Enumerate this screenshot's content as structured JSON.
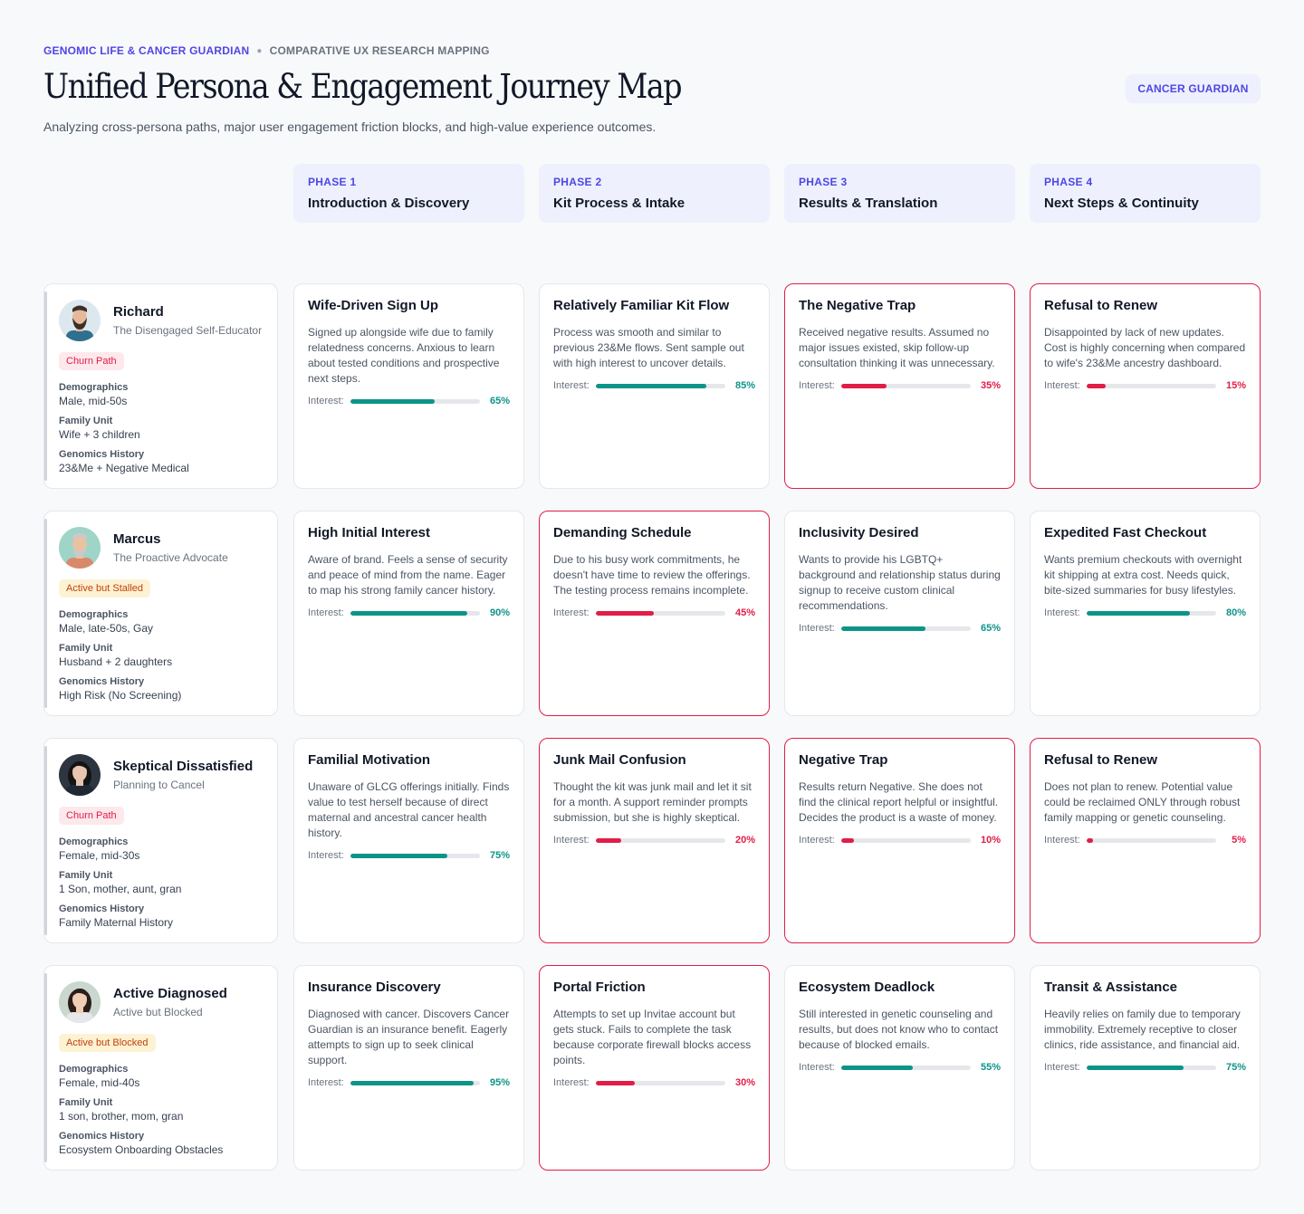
{
  "header": {
    "eyebrow_primary": "GENOMIC LIFE & CANCER GUARDIAN",
    "eyebrow_secondary": "COMPARATIVE UX RESEARCH MAPPING",
    "title": "Unified Persona & Engagement Journey Map",
    "subtitle": "Analyzing cross-persona paths, major user engagement friction blocks, and high-value experience outcomes.",
    "badge": "CANCER GUARDIAN"
  },
  "interest_label": "Interest:",
  "phases": [
    {
      "num": "PHASE 1",
      "title": "Introduction & Discovery"
    },
    {
      "num": "PHASE 2",
      "title": "Kit Process & Intake"
    },
    {
      "num": "PHASE 3",
      "title": "Results & Translation"
    },
    {
      "num": "PHASE 4",
      "title": "Next Steps & Continuity"
    }
  ],
  "personas": [
    {
      "name": "Richard",
      "role": "The Disengaged Self-Educator",
      "status": "Churn Path",
      "status_kind": "churn",
      "avatar": "man-beard-avatar",
      "labels": [
        "Demographics",
        "Family Unit",
        "Genomics History"
      ],
      "values": [
        "Male, mid-50s",
        "Wife + 3 children",
        "23&Me + Negative Medical"
      ]
    },
    {
      "name": "Marcus",
      "role": "The Proactive Advocate",
      "status": "Active but Stalled",
      "status_kind": "stalled",
      "avatar": "man-portrait-avatar",
      "labels": [
        "Demographics",
        "Family Unit",
        "Genomics History"
      ],
      "values": [
        "Male, late-50s, Gay",
        "Husband + 2 daughters",
        "High Risk (No Screening)"
      ]
    },
    {
      "name": "Skeptical Dissatisfied",
      "role": "Planning to Cancel",
      "status": "Churn Path",
      "status_kind": "churn",
      "avatar": "woman-dark-hair-avatar",
      "labels": [
        "Demographics",
        "Family Unit",
        "Genomics History"
      ],
      "values": [
        "Female, mid-30s",
        "1 Son, mother, aunt, gran",
        "Family Maternal History"
      ]
    },
    {
      "name": "Active Diagnosed",
      "role": "Active but Blocked",
      "status": "Active but Blocked",
      "status_kind": "stalled",
      "avatar": "woman-smiling-avatar",
      "labels": [
        "Demographics",
        "Family Unit",
        "Genomics History"
      ],
      "values": [
        "Female, mid-40s",
        "1 son, brother, mom, gran",
        "Ecosystem Onboarding Obstacles"
      ]
    }
  ],
  "cards": [
    [
      {
        "title": "Wife-Driven Sign Up",
        "desc": "Signed up alongside wife due to family relatedness concerns. Anxious to learn about tested conditions and prospective next steps.",
        "interest": 65,
        "pct": "65%",
        "friction": false
      },
      {
        "title": "Relatively Familiar Kit Flow",
        "desc": "Process was smooth and similar to previous 23&Me flows. Sent sample out with high interest to uncover details.",
        "interest": 85,
        "pct": "85%",
        "friction": false
      },
      {
        "title": "The Negative Trap",
        "desc": "Received negative results. Assumed no major issues existed, skip follow-up consultation thinking it was unnecessary.",
        "interest": 35,
        "pct": "35%",
        "friction": true
      },
      {
        "title": "Refusal to Renew",
        "desc": "Disappointed by lack of new updates. Cost is highly concerning when compared to wife's 23&Me ancestry dashboard.",
        "interest": 15,
        "pct": "15%",
        "friction": true
      }
    ],
    [
      {
        "title": "High Initial Interest",
        "desc": "Aware of brand. Feels a sense of security and peace of mind from the name. Eager to map his strong family cancer history.",
        "interest": 90,
        "pct": "90%",
        "friction": false
      },
      {
        "title": "Demanding Schedule",
        "desc": "Due to his busy work commitments, he doesn't have time to review the offerings. The testing process remains incomplete.",
        "interest": 45,
        "pct": "45%",
        "friction": true
      },
      {
        "title": "Inclusivity Desired",
        "desc": "Wants to provide his LGBTQ+ background and relationship status during signup to receive custom clinical recommendations.",
        "interest": 65,
        "pct": "65%",
        "friction": false
      },
      {
        "title": "Expedited Fast Checkout",
        "desc": "Wants premium checkouts with overnight kit shipping at extra cost. Needs quick, bite-sized summaries for busy lifestyles.",
        "interest": 80,
        "pct": "80%",
        "friction": false
      }
    ],
    [
      {
        "title": "Familial Motivation",
        "desc": "Unaware of GLCG offerings initially. Finds value to test herself because of direct maternal and ancestral cancer health history.",
        "interest": 75,
        "pct": "75%",
        "friction": false
      },
      {
        "title": "Junk Mail Confusion",
        "desc": "Thought the kit was junk mail and let it sit for a month. A support reminder prompts submission, but she is highly skeptical.",
        "interest": 20,
        "pct": "20%",
        "friction": true
      },
      {
        "title": "Negative Trap",
        "desc": "Results return Negative. She does not find the clinical report helpful or insightful. Decides the product is a waste of money.",
        "interest": 10,
        "pct": "10%",
        "friction": true
      },
      {
        "title": "Refusal to Renew",
        "desc": "Does not plan to renew. Potential value could be reclaimed ONLY through robust family mapping or genetic counseling.",
        "interest": 5,
        "pct": "5%",
        "friction": true
      }
    ],
    [
      {
        "title": "Insurance Discovery",
        "desc": "Diagnosed with cancer. Discovers Cancer Guardian is an insurance benefit. Eagerly attempts to sign up to seek clinical support.",
        "interest": 95,
        "pct": "95%",
        "friction": false
      },
      {
        "title": "Portal Friction",
        "desc": "Attempts to set up Invitae account but gets stuck. Fails to complete the task because corporate firewall blocks access points.",
        "interest": 30,
        "pct": "30%",
        "friction": true
      },
      {
        "title": "Ecosystem Deadlock",
        "desc": "Still interested in genetic counseling and results, but does not know who to contact because of blocked emails.",
        "interest": 55,
        "pct": "55%",
        "friction": false
      },
      {
        "title": "Transit & Assistance",
        "desc": "Heavily relies on family due to temporary immobility. Extremely receptive to closer clinics, ride assistance, and financial aid.",
        "interest": 75,
        "pct": "75%",
        "friction": false
      }
    ]
  ],
  "colors": {
    "accent": "#4f46e5",
    "positive": "#0d9488",
    "negative": "#e11d48"
  }
}
